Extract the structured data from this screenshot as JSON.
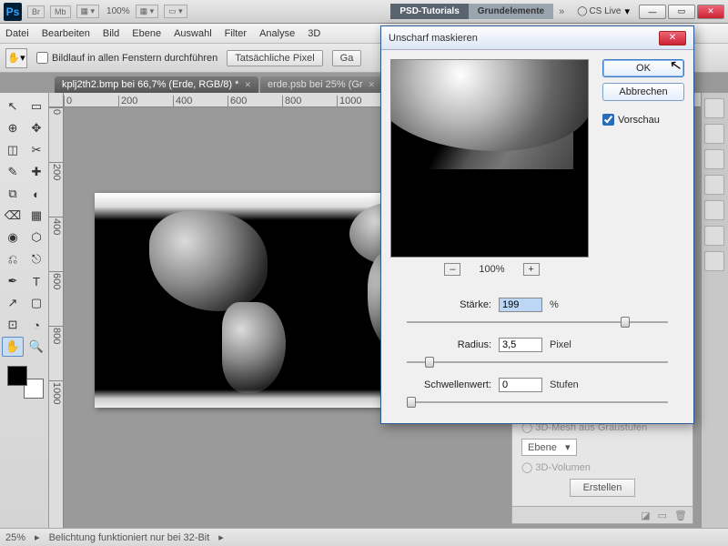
{
  "titlebar": {
    "mini1": "Br",
    "mini2": "Mb",
    "zoom": "100%",
    "top_tabs": [
      "PSD-Tutorials",
      "Grundelemente"
    ],
    "chevrons": "»",
    "cslive": "CS Live",
    "win_min": "—",
    "win_max": "▭",
    "win_close": "✕"
  },
  "menubar": [
    "Datei",
    "Bearbeiten",
    "Bild",
    "Ebene",
    "Auswahl",
    "Filter",
    "Analyse",
    "3D"
  ],
  "options": {
    "scroll_all": "Bildlauf in allen Fenstern durchführen",
    "actual_pixels": "Tatsächliche Pixel",
    "fit_screen": "Ga"
  },
  "doc_tabs": [
    {
      "label": "kplj2th2.bmp bei 66,7% (Erde, RGB/8) *"
    },
    {
      "label": "erde.psb bei 25% (Gr"
    }
  ],
  "ruler_h": [
    "0",
    "200",
    "400",
    "600",
    "800",
    "1000"
  ],
  "ruler_v": [
    "0",
    "200",
    "400",
    "600",
    "800",
    "1000"
  ],
  "tools": [
    "↖",
    "▭",
    "⊕",
    "✥",
    "◫",
    "✂",
    "✎",
    "✚",
    "⧉",
    "◐",
    "⌫",
    "▦",
    "◉",
    "⬡",
    "⎌",
    "⎋",
    "✒",
    "T",
    "↗",
    "▢",
    "⊡",
    "◔",
    "✋",
    "🔍"
  ],
  "statusbar": {
    "zoom": "25%",
    "info": "Belichtung funktioniert nur bei 32-Bit"
  },
  "dialog": {
    "title": "Unscharf maskieren",
    "ok": "OK",
    "cancel": "Abbrechen",
    "preview_check": "Vorschau",
    "zoom_minus": "–",
    "zoom_pct": "100%",
    "zoom_plus": "+",
    "strength_label": "Stärke:",
    "strength_value": "199",
    "strength_unit": "%",
    "radius_label": "Radius:",
    "radius_value": "3,5",
    "radius_unit": "Pixel",
    "threshold_label": "Schwellenwert:",
    "threshold_value": "0",
    "threshold_unit": "Stufen"
  },
  "bg_panel": {
    "opt1": "3D-Mesh aus Graustufen",
    "select": "Ebene",
    "opt2": "3D-Volumen",
    "create": "Erstellen"
  }
}
